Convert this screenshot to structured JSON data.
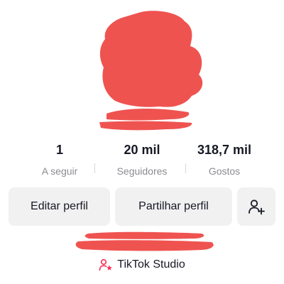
{
  "stats": [
    {
      "value": "1",
      "label": "A seguir"
    },
    {
      "value": "20 mil",
      "label": "Seguidores"
    },
    {
      "value": "318,7 mil",
      "label": "Gostos"
    }
  ],
  "buttons": {
    "edit_label": "Editar perfil",
    "share_label": "Partilhar perfil"
  },
  "studio": {
    "label": "TikTok Studio",
    "icon_color": "#fe2c55"
  },
  "colors": {
    "redaction": "#ef5350",
    "text": "#161823",
    "muted": "#8a8b91",
    "button_bg": "#f1f1f2"
  },
  "icons": [
    "add-friend-icon",
    "tiktok-studio-icon"
  ]
}
